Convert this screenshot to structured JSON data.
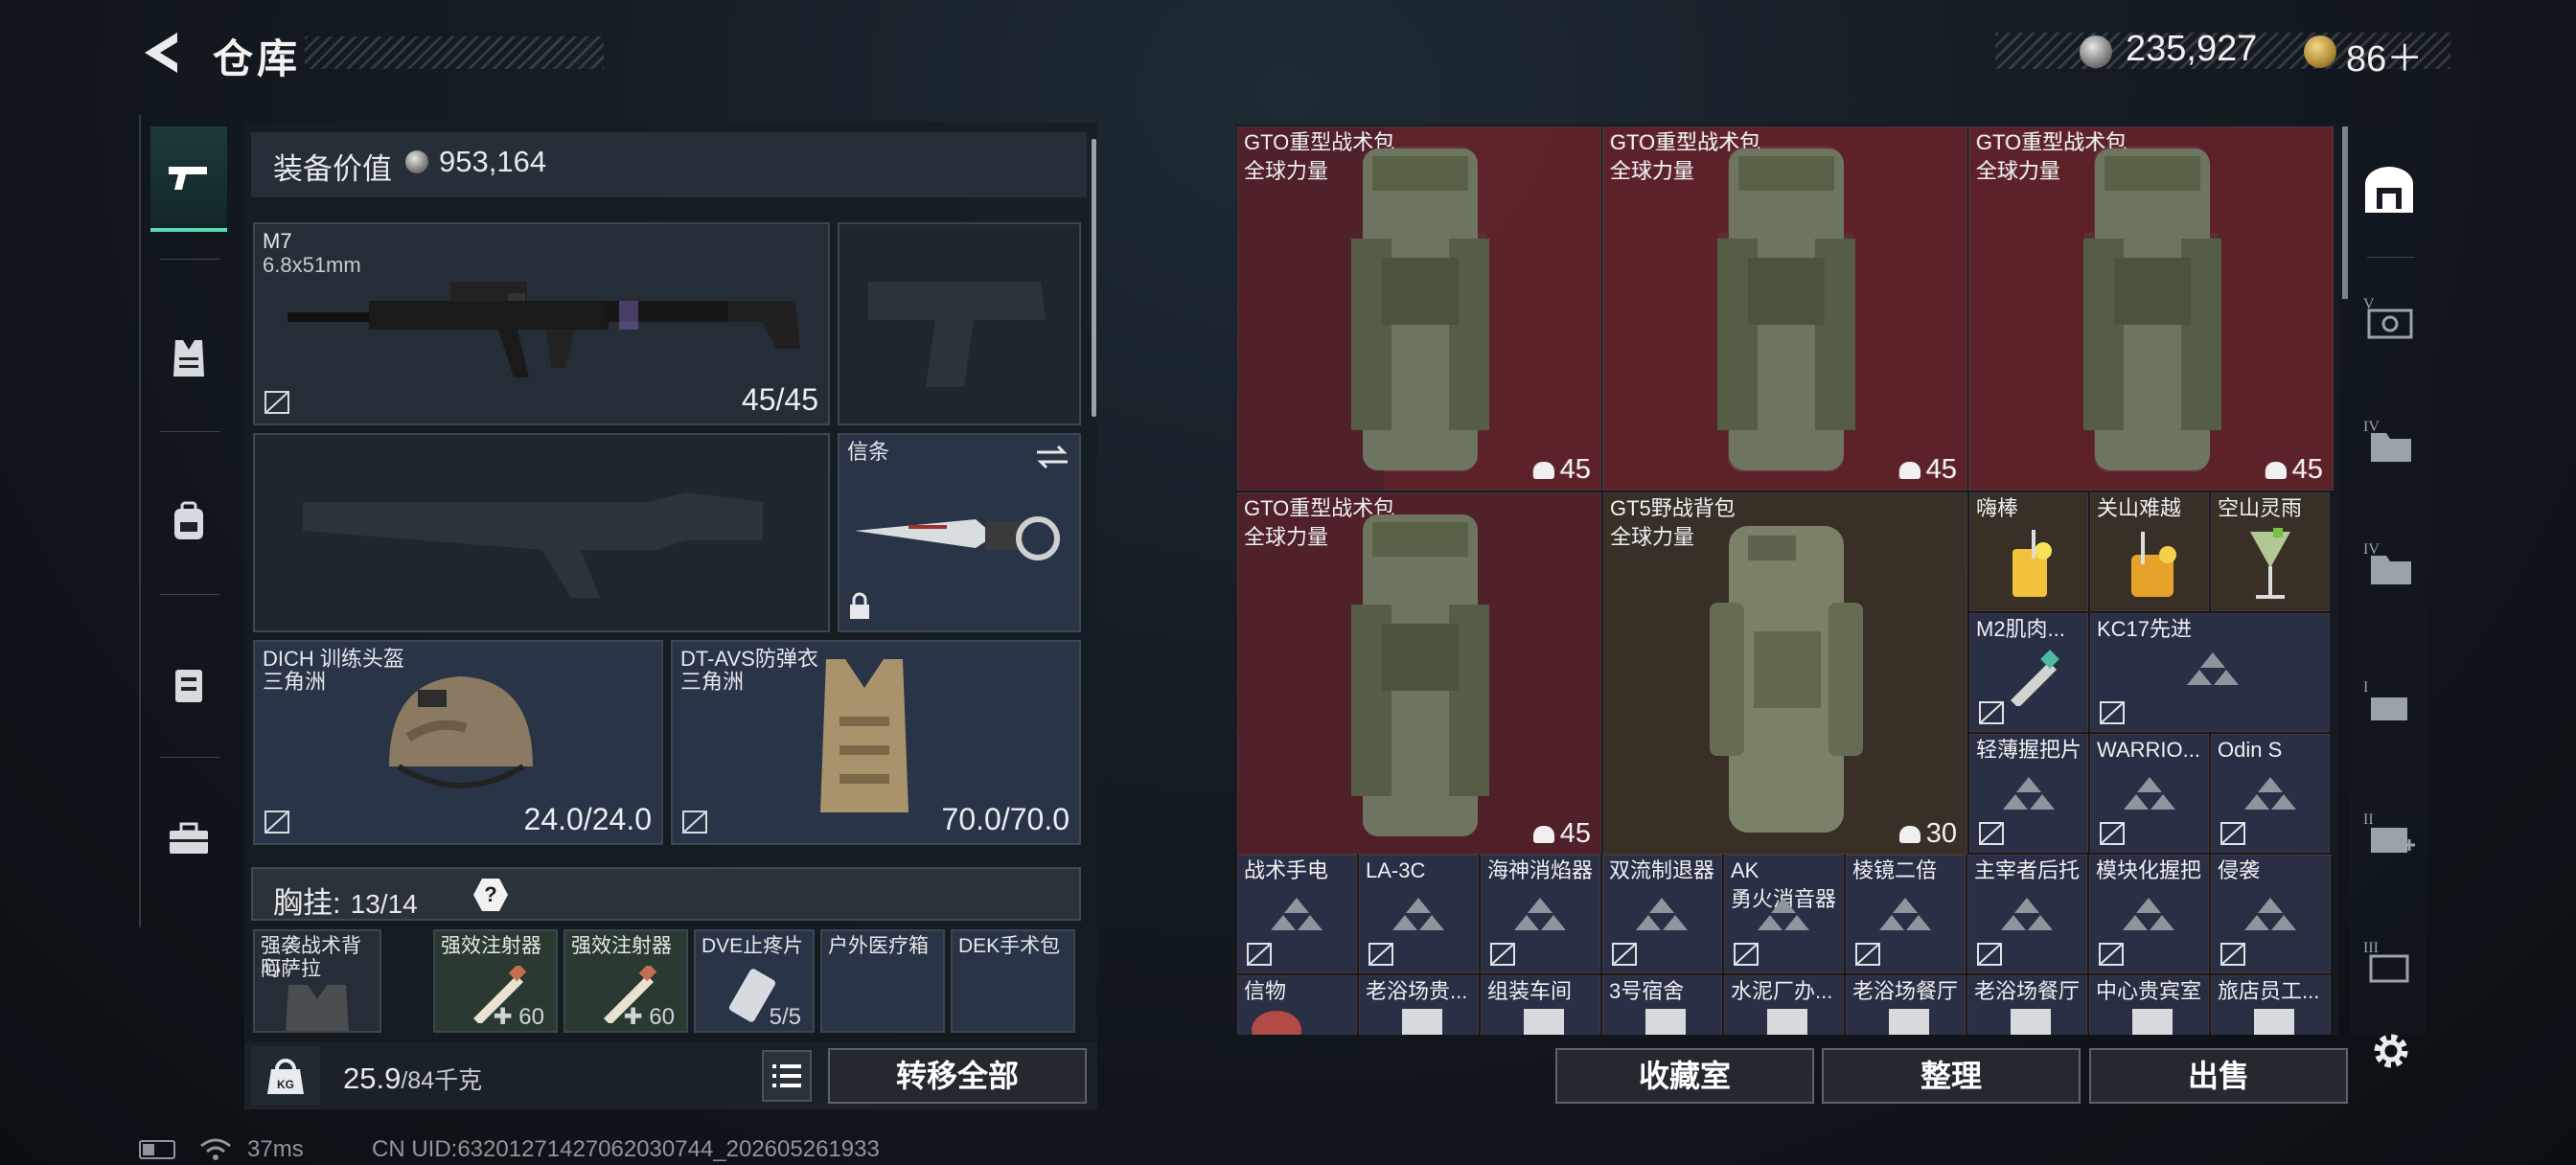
{
  "header": {
    "title": "仓库"
  },
  "currency": {
    "silver": "235,927",
    "gold": "86＋"
  },
  "categories": [
    "weapons",
    "armor",
    "backpack",
    "chest-rig",
    "toolbox"
  ],
  "equipment": {
    "value_label": "装备价值",
    "value": "953,164",
    "primary": {
      "name": "M7",
      "caliber": "6.8x51mm",
      "ammo": "45/45"
    },
    "melee": {
      "name": "信条"
    },
    "helmet": {
      "name": "DICH 训练头盔",
      "origin": "三角洲",
      "durability": "24.0/24.0"
    },
    "armor": {
      "name": "DT-AVS防弹衣",
      "origin": "三角洲",
      "durability": "70.0/70.0"
    },
    "chest": {
      "label": "胸挂:",
      "count": "13/14",
      "help": "?",
      "items": [
        {
          "name": "强袭战术背心",
          "sub": "阿萨拉",
          "count": ""
        },
        {
          "name": "强效注射器",
          "sub": "",
          "count": "60"
        },
        {
          "name": "强效注射器",
          "sub": "",
          "count": "60"
        },
        {
          "name": "DVE止疼片",
          "sub": "",
          "count": "5/5"
        },
        {
          "name": "户外医疗箱",
          "sub": "",
          "count": ""
        },
        {
          "name": "DEK手术包",
          "sub": "",
          "count": ""
        }
      ]
    }
  },
  "bottom_left": {
    "weight_icon": "KG",
    "weight": "25.9",
    "weight_max": "/84千克",
    "move_all": "转移全部"
  },
  "status": {
    "ping": "37ms",
    "uid": "CN UID:6320127142706203074​4_202605261933"
  },
  "stash": {
    "big_items": [
      {
        "name": "GTO重型战术包",
        "sub": "全球力量",
        "capacity": "45"
      },
      {
        "name": "GTO重型战术包",
        "sub": "全球力量",
        "capacity": "45"
      },
      {
        "name": "GTO重型战术包",
        "sub": "全球力量",
        "capacity": "45"
      },
      {
        "name": "GTO重型战术包",
        "sub": "全球力量",
        "capacity": "45"
      },
      {
        "name": "GT5野战背包",
        "sub": "全球力量",
        "capacity": "30"
      }
    ],
    "drinks": [
      {
        "name": "嗨棒"
      },
      {
        "name": "关山难越"
      },
      {
        "name": "空山灵雨"
      }
    ],
    "small_items": [
      {
        "name": "M2肌肉..."
      },
      {
        "name": "KC17先进"
      },
      {
        "name": "轻薄握把片"
      },
      {
        "name": "WARRIO..."
      },
      {
        "name": "Odin S"
      }
    ],
    "row5": [
      {
        "name": "战术手电"
      },
      {
        "name": "LA-3C"
      },
      {
        "name": "海神消焰器"
      },
      {
        "name": "双流制退器"
      },
      {
        "name": "AK",
        "sub": "勇火消音器"
      },
      {
        "name": "棱镜二倍"
      },
      {
        "name": "主宰者后托"
      },
      {
        "name": "模块化握把"
      },
      {
        "name": "侵袭"
      }
    ],
    "row6": [
      {
        "name": "信物"
      },
      {
        "name": "老浴场贵..."
      },
      {
        "name": "组装车间"
      },
      {
        "name": "3号宿舍"
      },
      {
        "name": "水泥厂办..."
      },
      {
        "name": "老浴场餐厅"
      },
      {
        "name": "老浴场餐厅"
      },
      {
        "name": "中心贵宾室"
      },
      {
        "name": "旅店员工..."
      }
    ]
  },
  "right_tabs": [
    "vault-icon",
    "tier-v-icon",
    "tier-iv-icon",
    "tier-iv-icon",
    "tier-i-icon",
    "tier-ii-icon",
    "tier-iii-icon"
  ],
  "buttons": {
    "vault": "收藏室",
    "sort": "整理",
    "sell": "出售"
  },
  "colors": {
    "accent": "#5fd9b1",
    "stash_red": "#62222a",
    "stash_blue": "#2e344a"
  }
}
